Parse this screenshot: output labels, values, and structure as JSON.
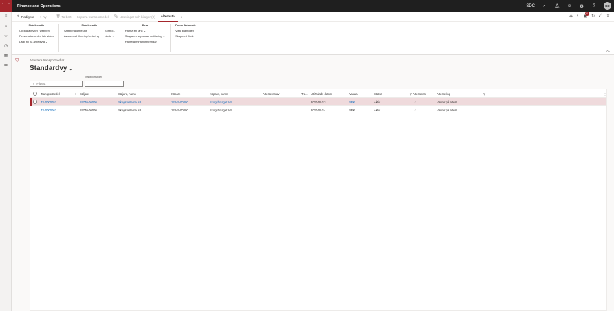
{
  "header": {
    "app_title": "Finance and Operations",
    "company": "SDC",
    "avatar_initials": "KD",
    "accent_color": "#a4262c"
  },
  "tabs": [
    {
      "label": "Redigera",
      "icon": "edit-icon",
      "enabled": true
    },
    {
      "label": "Ny",
      "icon": "add-icon",
      "enabled": false
    },
    {
      "label": "Ta bort",
      "icon": "delete-icon",
      "enabled": false
    },
    {
      "label": "Kopiera transportsedel",
      "enabled": false
    },
    {
      "label": "Noteringar och bilagor (0)",
      "icon": "attachment-icon",
      "enabled": false
    },
    {
      "label": "Alternativ",
      "enabled": true,
      "active": true
    }
  ],
  "notifications_count": "0",
  "ribbon": {
    "groups": [
      {
        "title": "Sidalternativ",
        "columns": [
          [
            "Öppna aktivitet i webben",
            "Personalisera den här sidan",
            "Lägg till på arbetsyta"
          ]
        ]
      },
      {
        "title": "Sidalternativ",
        "columns": [
          [
            "Sätt behållarbeslut",
            "Avancerad filtrering/sortering"
          ],
          [
            "Kontroll-",
            "värde"
          ]
        ]
      },
      {
        "title": "Dela",
        "columns": [
          [
            "Hämta en länk",
            "Skapa en anpassad notifiering",
            "Hantera mina notifieringar"
          ]
        ]
      },
      {
        "title": "Power Automate",
        "columns": [
          [
            "Visa alla flöden",
            "Skapa ett flöde"
          ]
        ]
      }
    ]
  },
  "page": {
    "caption": "Attestera transportsedlar",
    "view_name": "Standardvy",
    "filter_placeholder": "Filtrera",
    "field_label": "Transportsedel"
  },
  "grid": {
    "columns": [
      "Transportsedel",
      "Säljare",
      "Säljare, namn",
      "Köpare",
      "Köpare, namn",
      "Attesteras av",
      "Tra...",
      "Utfärdade datum",
      "Valuta",
      "Status",
      "Attesteras",
      "Attestering"
    ],
    "rows": [
      {
        "transportsedel": "TS-0000057",
        "saljare": "19740-00000",
        "saljare_namn": "Skogsfastarna AB",
        "kopare": "12345-00000",
        "kopare_namn": "Skogsbolaget AB",
        "attesteras_av": "",
        "tra": "",
        "datum": "2020-01-13",
        "valuta": "SEK",
        "status": "Aktiv",
        "attesteras": "✓",
        "attestering": "Väntar på attest",
        "selected": true
      },
      {
        "transportsedel": "TS-0000063",
        "saljare": "19740-00000",
        "saljare_namn": "Skogsfastarna AB",
        "kopare": "12345-00000",
        "kopare_namn": "Skogsbolaget AB",
        "attesteras_av": "",
        "tra": "",
        "datum": "2020-01-14",
        "valuta": "SEK",
        "status": "Aktiv",
        "attesteras": "✓",
        "attestering": "Väntar på attest",
        "selected": false
      }
    ]
  }
}
